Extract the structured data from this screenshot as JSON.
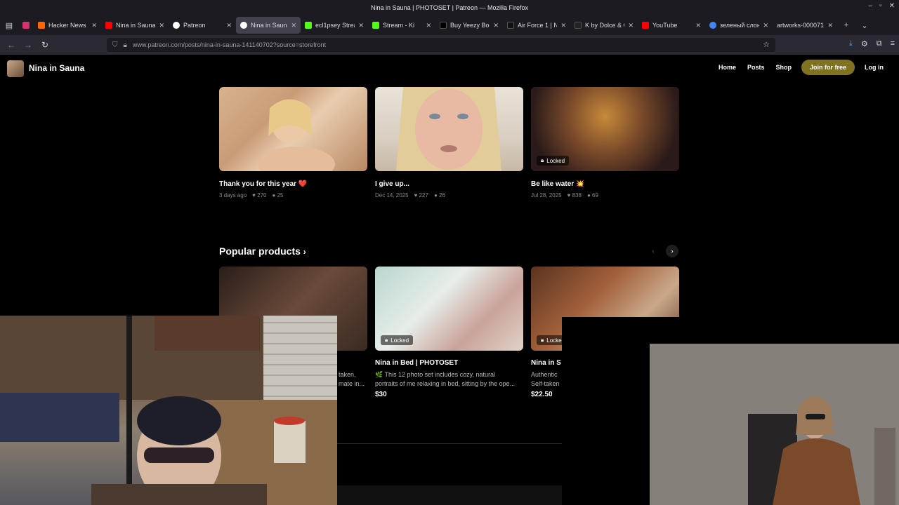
{
  "window": {
    "title": "Nina in Sauna | PHOTOSET | Patreon — Mozilla Firefox",
    "controls": [
      "–",
      "▫",
      "✕"
    ]
  },
  "tabs": [
    {
      "label": "",
      "color": "#d6336c"
    },
    {
      "label": "Hacker News",
      "color": "#ff6600"
    },
    {
      "label": "Nina in Sauna",
      "color": "#ff0000"
    },
    {
      "label": "Patreon",
      "color": "#ffffff"
    },
    {
      "label": "Nina in Sauna",
      "color": "#ffffff",
      "active": true
    },
    {
      "label": "ecl1psey Strea",
      "color": "#53fc18"
    },
    {
      "label": "Stream - Ki",
      "color": "#53fc18"
    },
    {
      "label": "Buy Yeezy Boo",
      "color": "#000000"
    },
    {
      "label": "Air Force 1 | N",
      "color": "#111111"
    },
    {
      "label": "K by Dolce & G",
      "color": "#222222"
    },
    {
      "label": "YouTube",
      "color": "#ff0000"
    },
    {
      "label": "зеленый слон",
      "color": "#4285f4"
    },
    {
      "label": "artworks-000071",
      "color": "#ff5500"
    }
  ],
  "nav": {
    "url": "www.patreon.com/posts/nina-in-sauna-141140702?source=storefront"
  },
  "site": {
    "name": "Nina in Sauna",
    "links": [
      "Home",
      "Posts",
      "Shop"
    ],
    "join_label": "Join for free",
    "login_label": "Log in"
  },
  "posts": [
    {
      "title": "Thank you for this year ❤️",
      "date": "3 days ago",
      "likes": "270",
      "comments": "25",
      "locked": false
    },
    {
      "title": "I give up...",
      "date": "Dec 14, 2025",
      "likes": "227",
      "comments": "26",
      "locked": false
    },
    {
      "title": "Be like water 💥",
      "date": "Jul 28, 2025",
      "likes": "838",
      "comments": "69",
      "locked": true
    }
  ],
  "locked_label": "Locked",
  "popular": {
    "title": "Popular products",
    "products": [
      {
        "title": "",
        "desc1": "taken,",
        "desc2": "mate in...",
        "price": ""
      },
      {
        "title": "Nina in Bed | PHOTOSET",
        "desc1": "🌿 This 12 photo set includes cozy, natural",
        "desc2": "portraits of me relaxing in bed, sitting by the ope...",
        "price": "$30"
      },
      {
        "title": "Nina in S",
        "desc1": "Authentic",
        "desc2": "Self-taken",
        "price": "$22.50"
      }
    ]
  },
  "icons": [
    "sidebar-icon",
    "back-icon",
    "forward-icon",
    "reload-icon",
    "shield-icon",
    "lock-icon",
    "star-icon",
    "download-icon",
    "extension-icon",
    "menu-icon",
    "heart-icon",
    "comment-icon",
    "chevron-left-icon",
    "chevron-right-icon",
    "plus-icon",
    "chevron-down-icon"
  ]
}
